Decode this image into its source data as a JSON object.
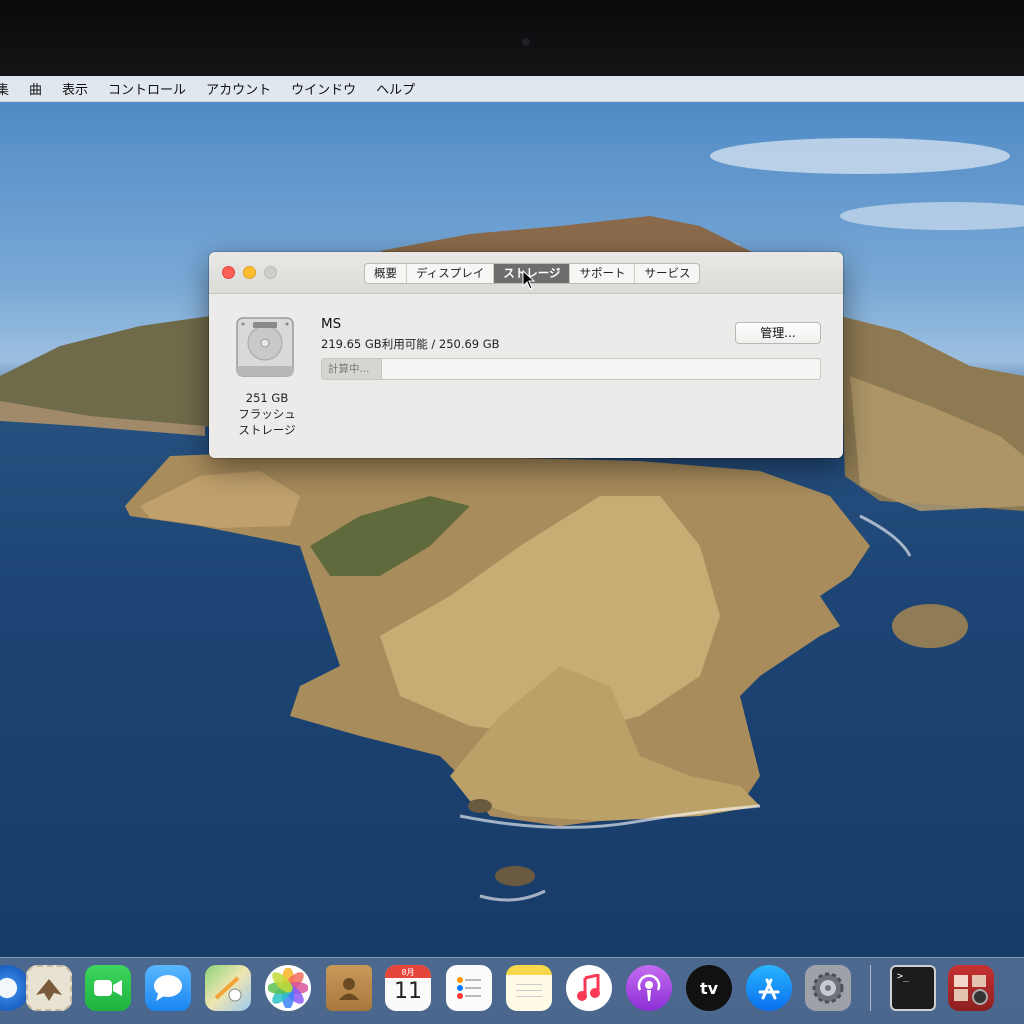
{
  "menubar": {
    "items": [
      "集",
      "曲",
      "表示",
      "コントロール",
      "アカウント",
      "ウインドウ",
      "ヘルプ"
    ]
  },
  "window": {
    "tabs": [
      {
        "label": "概要",
        "active": false
      },
      {
        "label": "ディスプレイ",
        "active": false
      },
      {
        "label": "ストレージ",
        "active": true
      },
      {
        "label": "サポート",
        "active": false
      },
      {
        "label": "サービス",
        "active": false
      }
    ],
    "disk": {
      "caption_line1": "251 GB",
      "caption_line2": "フラッシュ",
      "caption_line3": "ストレージ"
    },
    "volume": {
      "name": "MS",
      "info": "219.65 GB利用可能 / 250.69 GB",
      "bar_label": "計算中...",
      "bar_progress_fraction": 0.12
    },
    "manage_button": "管理..."
  },
  "dock": {
    "calendar_month": "8月",
    "calendar_day": "11",
    "apps": [
      "safari-icon",
      "mail-icon",
      "facetime-icon",
      "messages-icon",
      "maps-icon",
      "photos-icon",
      "contacts-icon",
      "calendar-icon",
      "reminders-icon",
      "notes-icon",
      "music-icon",
      "podcasts-icon",
      "apple-tv-icon",
      "app-store-icon",
      "system-preferences-icon",
      "terminal-icon",
      "photo-booth-icon"
    ],
    "apple_tv_label": "tv"
  },
  "colors": {
    "close": "#fe5f57",
    "minimize": "#febc2e",
    "active_tab": "#6e6d6b"
  }
}
